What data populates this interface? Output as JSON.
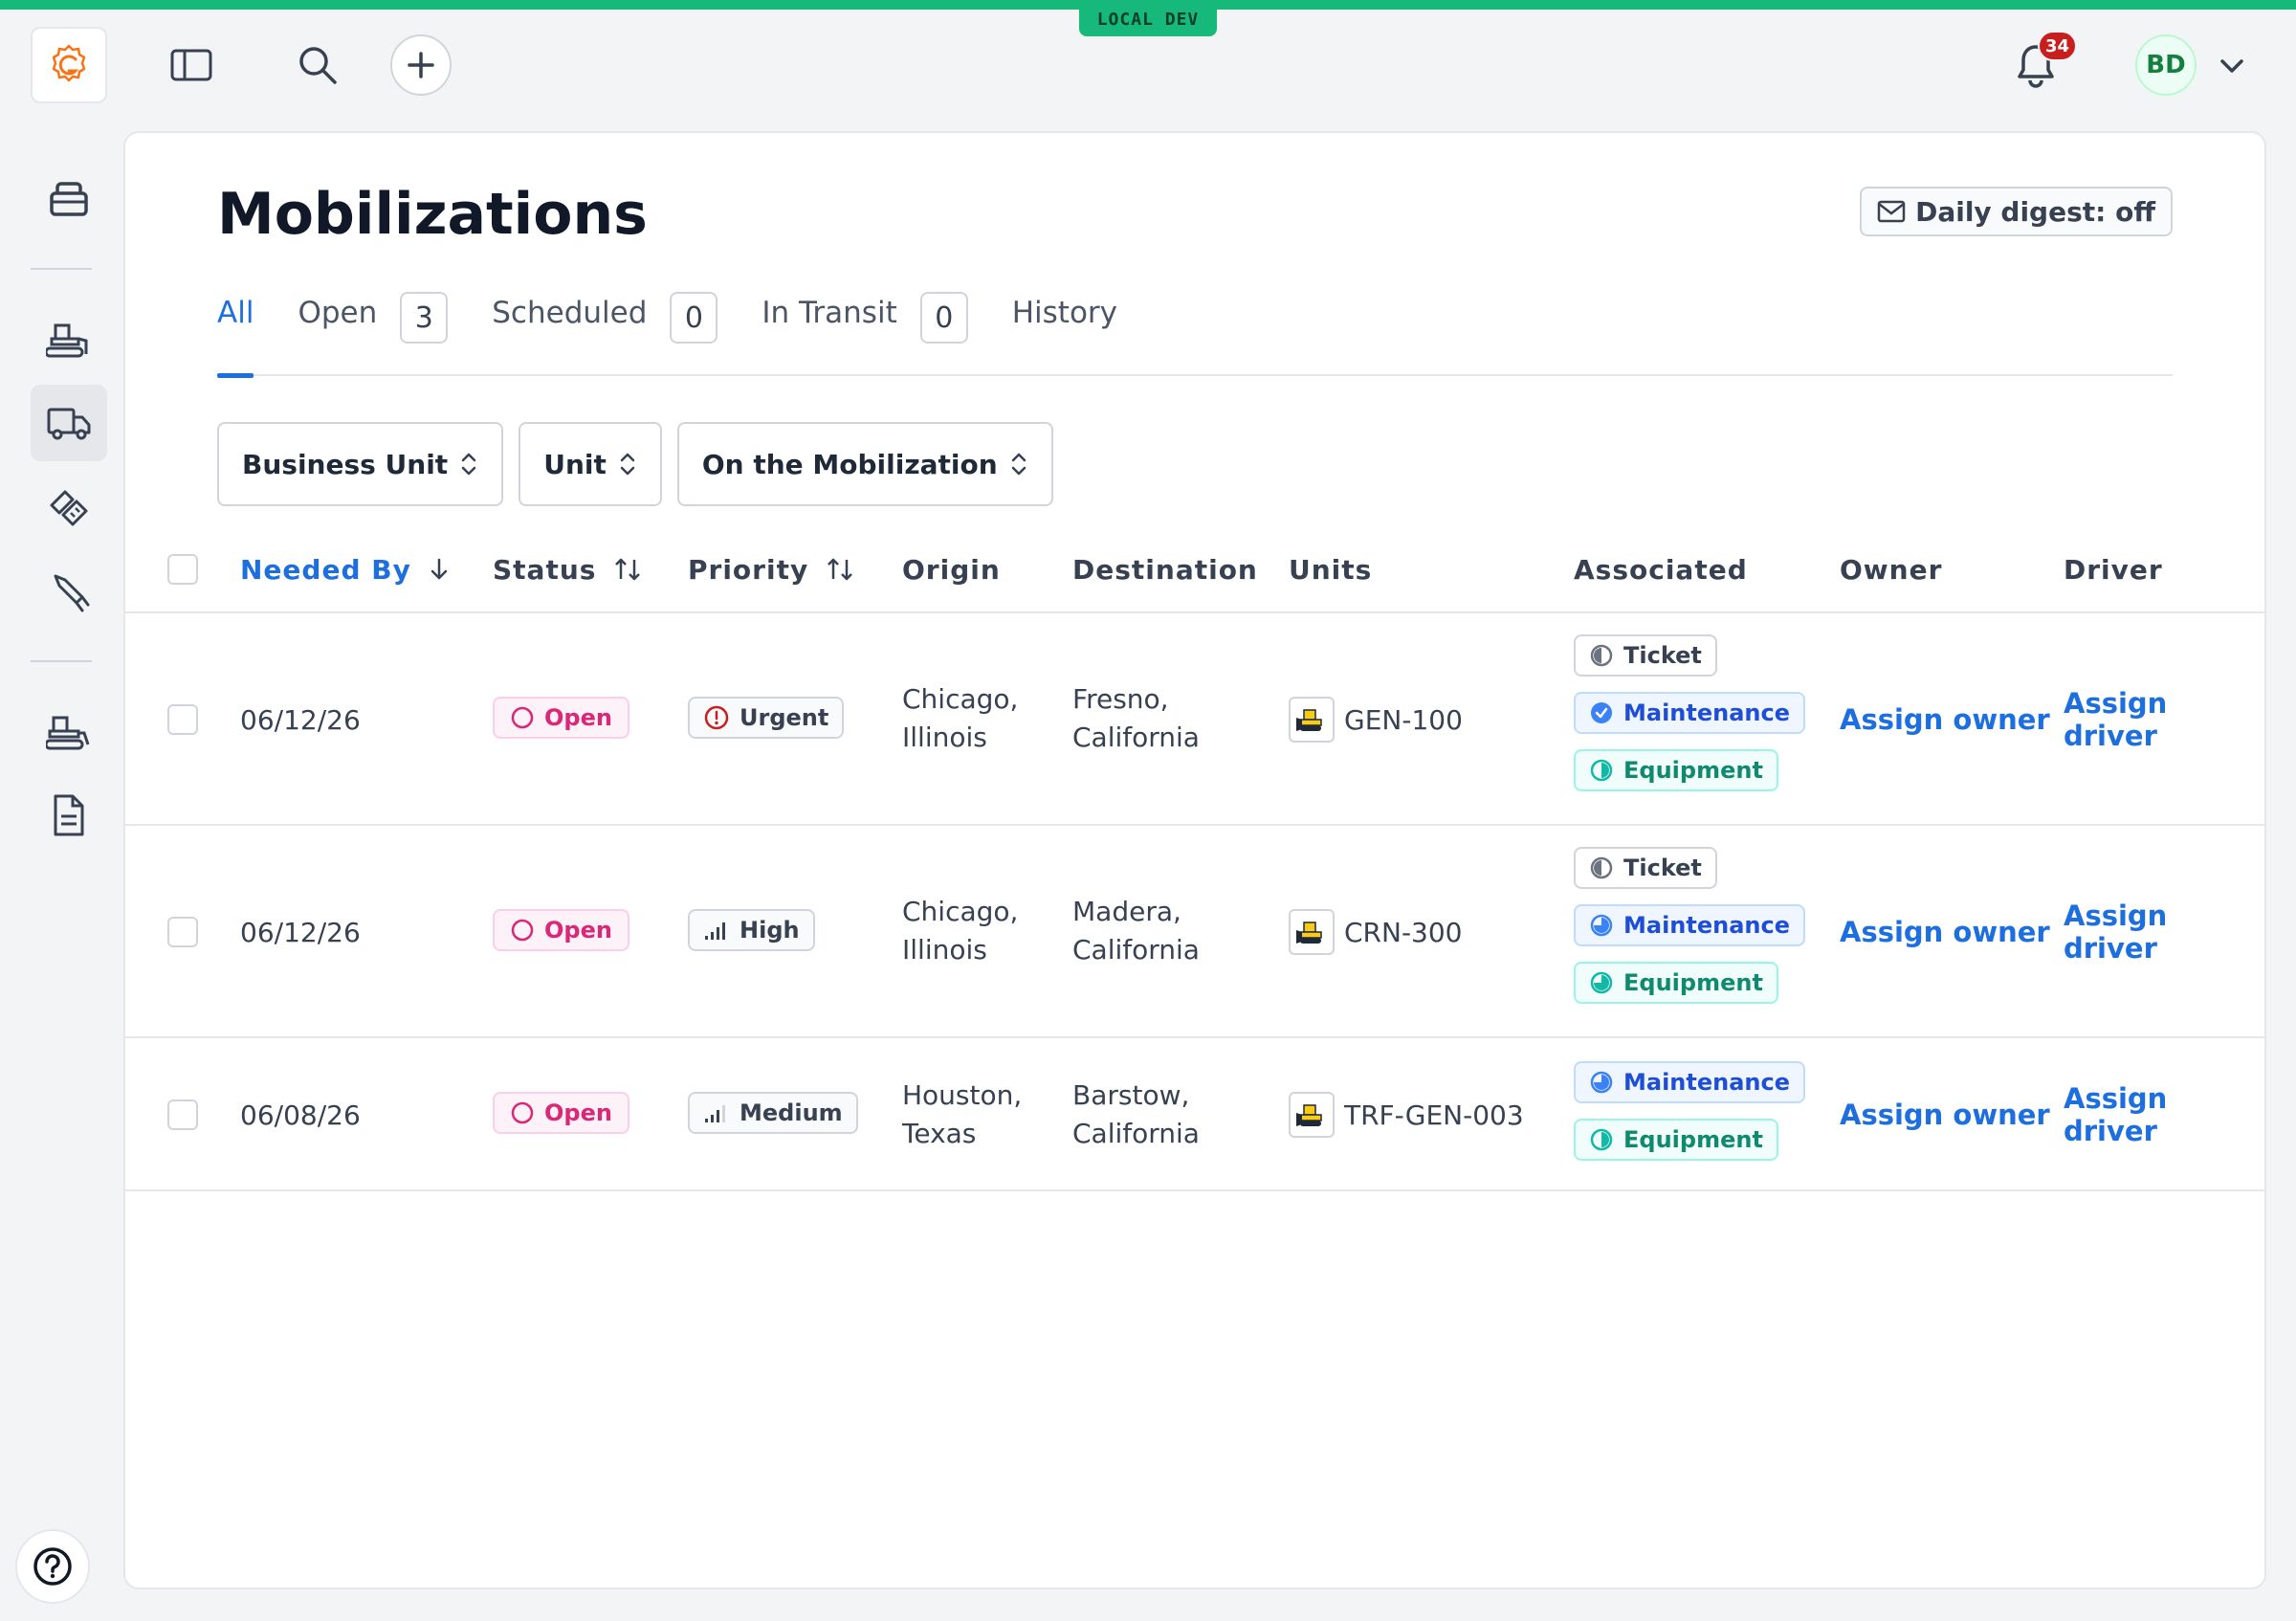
{
  "env": {
    "label": "LOCAL DEV"
  },
  "topbar": {
    "notifications_count": "34",
    "avatar_initials": "BD"
  },
  "page": {
    "title": "Mobilizations",
    "digest_label": "Daily digest: off"
  },
  "tabs": [
    {
      "label": "All",
      "count": null
    },
    {
      "label": "Open",
      "count": "3"
    },
    {
      "label": "Scheduled",
      "count": "0"
    },
    {
      "label": "In Transit",
      "count": "0"
    },
    {
      "label": "History",
      "count": null
    }
  ],
  "filters": [
    {
      "label": "Business Unit"
    },
    {
      "label": "Unit"
    },
    {
      "label": "On the Mobilization"
    }
  ],
  "table": {
    "columns": {
      "needed_by": "Needed By",
      "status": "Status",
      "priority": "Priority",
      "origin": "Origin",
      "destination": "Destination",
      "units": "Units",
      "associated": "Associated",
      "owner": "Owner",
      "driver": "Driver"
    },
    "rows": [
      {
        "needed_by": "06/12/26",
        "status": "Open",
        "priority": "Urgent",
        "origin_line1": "Chicago,",
        "origin_line2": "Illinois",
        "destination_line1": "Fresno,",
        "destination_line2": "California",
        "unit": "GEN-100",
        "associated": [
          "Ticket",
          "Maintenance",
          "Equipment"
        ],
        "owner": "Assign owner",
        "driver": "Assign driver"
      },
      {
        "needed_by": "06/12/26",
        "status": "Open",
        "priority": "High",
        "origin_line1": "Chicago,",
        "origin_line2": "Illinois",
        "destination_line1": "Madera,",
        "destination_line2": "California",
        "unit": "CRN-300",
        "associated": [
          "Ticket",
          "Maintenance",
          "Equipment"
        ],
        "owner": "Assign owner",
        "driver": "Assign driver"
      },
      {
        "needed_by": "06/08/26",
        "status": "Open",
        "priority": "Medium",
        "origin_line1": "Houston,",
        "origin_line2": "Texas",
        "destination_line1": "Barstow,",
        "destination_line2": "California",
        "unit": "TRF-GEN-003",
        "associated": [
          "Maintenance",
          "Equipment"
        ],
        "owner": "Assign owner",
        "driver": "Assign driver"
      }
    ]
  },
  "colors": {
    "accent": "#1d6fe0",
    "env_green": "#16b97a",
    "status_open": "#db2777",
    "urgent_red": "#c81e1e"
  },
  "icons": {
    "logo": "gear-logo-icon",
    "sidebar_toggle": "sidebar-toggle-icon",
    "search": "search-icon",
    "add": "plus-icon",
    "bell": "bell-icon",
    "help": "help-circle-icon"
  }
}
